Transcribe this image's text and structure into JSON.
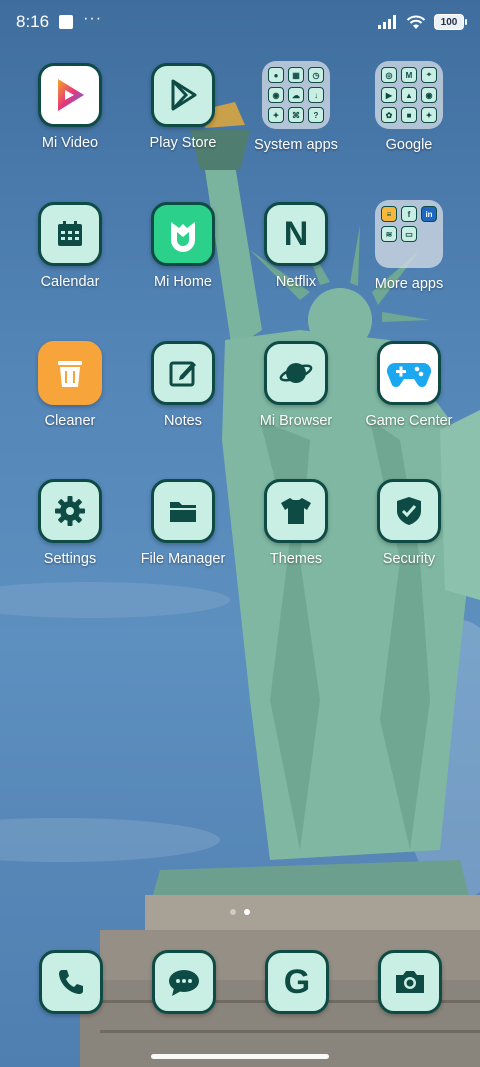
{
  "status_bar": {
    "time": "8:16",
    "battery": "100",
    "more_glyph": "···"
  },
  "apps": [
    {
      "label": "Mi Video",
      "icon": "play-triangle-icon"
    },
    {
      "label": "Play Store",
      "icon": "play-store-icon"
    },
    {
      "label": "System apps",
      "icon": "folder-icon"
    },
    {
      "label": "Google",
      "icon": "folder-icon"
    },
    {
      "label": "Calendar",
      "icon": "calendar-icon"
    },
    {
      "label": "Mi Home",
      "icon": "mi-home-icon"
    },
    {
      "label": "Netflix",
      "icon": "netflix-icon",
      "glyph": "N"
    },
    {
      "label": "More apps",
      "icon": "folder-icon"
    },
    {
      "label": "Cleaner",
      "icon": "trash-icon"
    },
    {
      "label": "Notes",
      "icon": "notes-icon"
    },
    {
      "label": "Mi Browser",
      "icon": "planet-icon"
    },
    {
      "label": "Game Center",
      "icon": "gamepad-icon"
    },
    {
      "label": "Settings",
      "icon": "gear-icon"
    },
    {
      "label": "File Manager",
      "icon": "folder-file-icon"
    },
    {
      "label": "Themes",
      "icon": "tshirt-icon"
    },
    {
      "label": "Security",
      "icon": "shield-icon"
    }
  ],
  "dock": [
    {
      "name": "phone",
      "icon": "phone-icon"
    },
    {
      "name": "messaging",
      "icon": "chat-icon"
    },
    {
      "name": "google-search",
      "icon": "google-icon",
      "glyph": "G"
    },
    {
      "name": "camera",
      "icon": "camera-icon"
    }
  ],
  "colors": {
    "icon_bg": "#c9eee3",
    "icon_border": "#0f4b45",
    "sky": "#5486b8",
    "statue": "#7fb7a2"
  },
  "page_indicator": {
    "pages": 2,
    "current": 2
  }
}
